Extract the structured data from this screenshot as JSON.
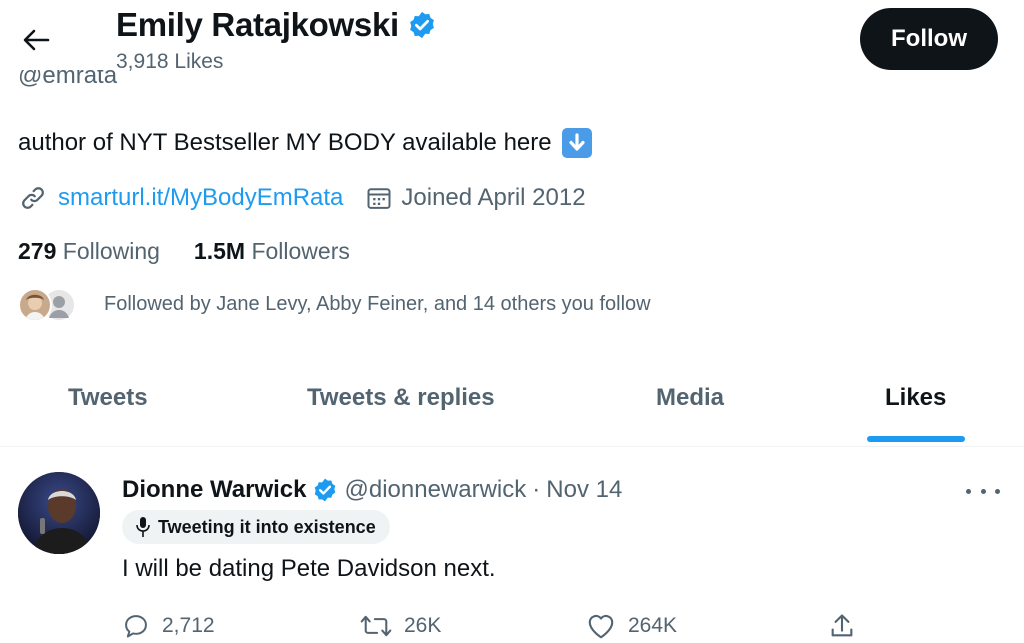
{
  "header": {
    "name": "Emily Ratajkowski",
    "likes_count": "3,918 Likes",
    "follow_label": "Follow",
    "handle_partial": "@emrata"
  },
  "profile": {
    "bio": "author of NYT Bestseller MY BODY available here",
    "link": "smarturl.it/MyBodyEmRata",
    "joined": "Joined April 2012",
    "following_count": "279",
    "following_label": "Following",
    "followers_count": "1.5M",
    "followers_label": "Followers",
    "followed_by": "Followed by Jane Levy, Abby Feiner, and 14 others you follow"
  },
  "tabs": [
    {
      "label": "Tweets",
      "active": false
    },
    {
      "label": "Tweets & replies",
      "active": false
    },
    {
      "label": "Media",
      "active": false
    },
    {
      "label": "Likes",
      "active": true
    }
  ],
  "tweet": {
    "author": "Dionne Warwick",
    "handle": "@dionnewarwick",
    "separator": "·",
    "date": "Nov 14",
    "status_label": "Tweeting it into existence",
    "text": "I will be dating Pete Davidson next.",
    "replies": "2,712",
    "retweets": "26K",
    "likes": "264K"
  },
  "colors": {
    "accent": "#1d9bf0",
    "text_primary": "#0f1419",
    "text_secondary": "#536471",
    "follow_button_bg": "#0f1419"
  },
  "icons": [
    "back-arrow-icon",
    "verified-badge-icon",
    "down-arrow-emoji-icon",
    "link-icon",
    "calendar-icon",
    "more-icon",
    "microphone-icon",
    "reply-icon",
    "retweet-icon",
    "like-icon",
    "share-icon"
  ]
}
